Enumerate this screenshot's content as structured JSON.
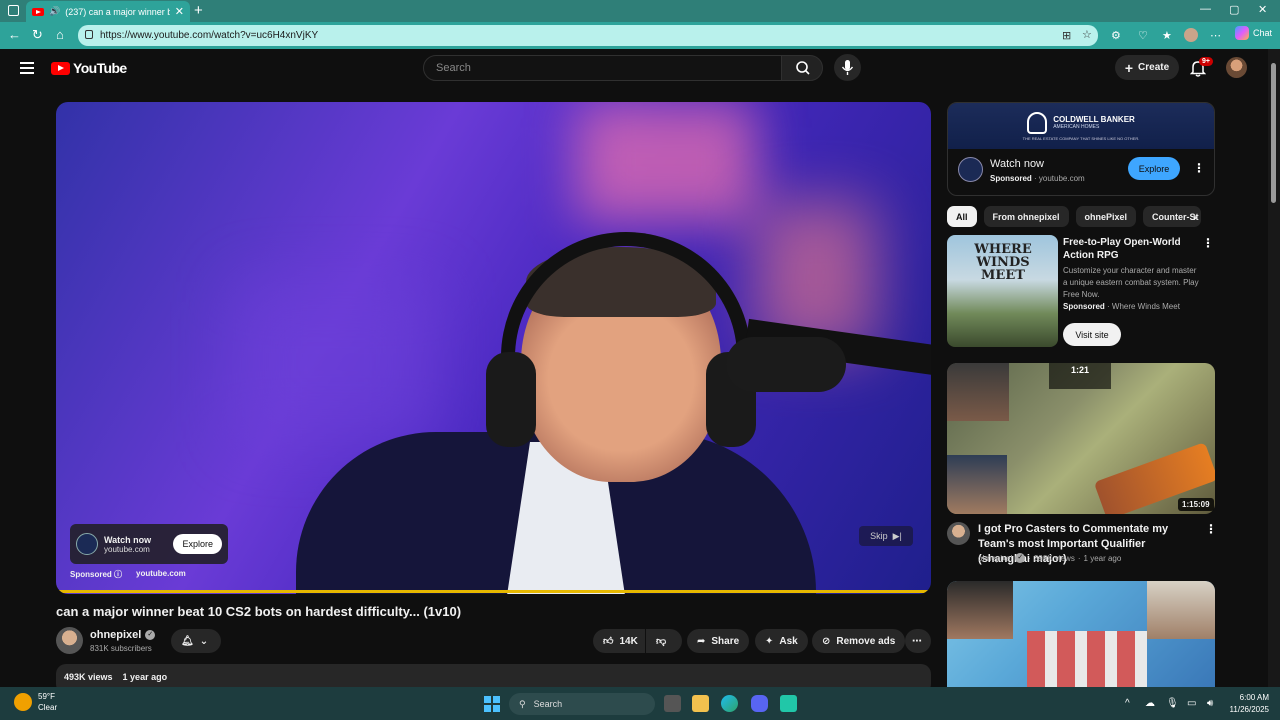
{
  "browser": {
    "tab_title": "(237) can a major winner be...",
    "url": "https://www.youtube.com/watch?v=uc6H4xnVjKY",
    "chat_label": "Chat"
  },
  "header": {
    "logo_text": "YouTube",
    "search_placeholder": "Search",
    "create_label": "Create",
    "notification_count": "9+"
  },
  "video": {
    "title": "can a major winner beat 10 CS2 bots on hardest difficulty... (1v10)",
    "overlay_ad": {
      "title": "Watch now",
      "domain": "youtube.com",
      "button": "Explore",
      "sponsored": "Sponsored",
      "footer_domain": "youtube.com"
    },
    "skip_label": "Skip",
    "progress": 1.0
  },
  "channel": {
    "name": "ohnepixel",
    "subscribers": "831K subscribers"
  },
  "actions": {
    "likes": "14K",
    "share": "Share",
    "ask": "Ask",
    "remove_ads": "Remove ads"
  },
  "description": {
    "views": "493K views",
    "age": "1 year ago"
  },
  "sidebar": {
    "ad": {
      "brand_line1": "COLDWELL BANKER",
      "brand_line2": "AMERICAN HOMES",
      "tagline": "THE REAL ESTATE COMPANY THAT SHINES LIKE NO OTHER.",
      "title": "Watch now",
      "sponsored": "Sponsored",
      "domain": "youtube.com",
      "button": "Explore"
    },
    "chips": [
      "All",
      "From ohnepixel",
      "ohnePixel",
      "Counter-St"
    ],
    "sponsored_item": {
      "thumb_text": "WHERE WINDS MEET",
      "title": "Free-to-Play Open-World Action RPG",
      "desc": "Customize your character and master a unique eastern combat system. Play Free Now.",
      "sponsored": "Sponsored",
      "advertiser": "Where Winds Meet",
      "button": "Visit site"
    },
    "video2": {
      "hud_time": "1:21",
      "duration": "1:15:09",
      "title": "I got Pro Casters to Commentate my Team's most Important Qualifier (shanghai major)",
      "channel": "ohnepixel",
      "views": "398K views",
      "age": "1 year ago"
    }
  },
  "taskbar": {
    "temp": "59°F",
    "condition": "Clear",
    "search": "Search",
    "time": "6:00 AM",
    "date": "11/26/2025"
  }
}
